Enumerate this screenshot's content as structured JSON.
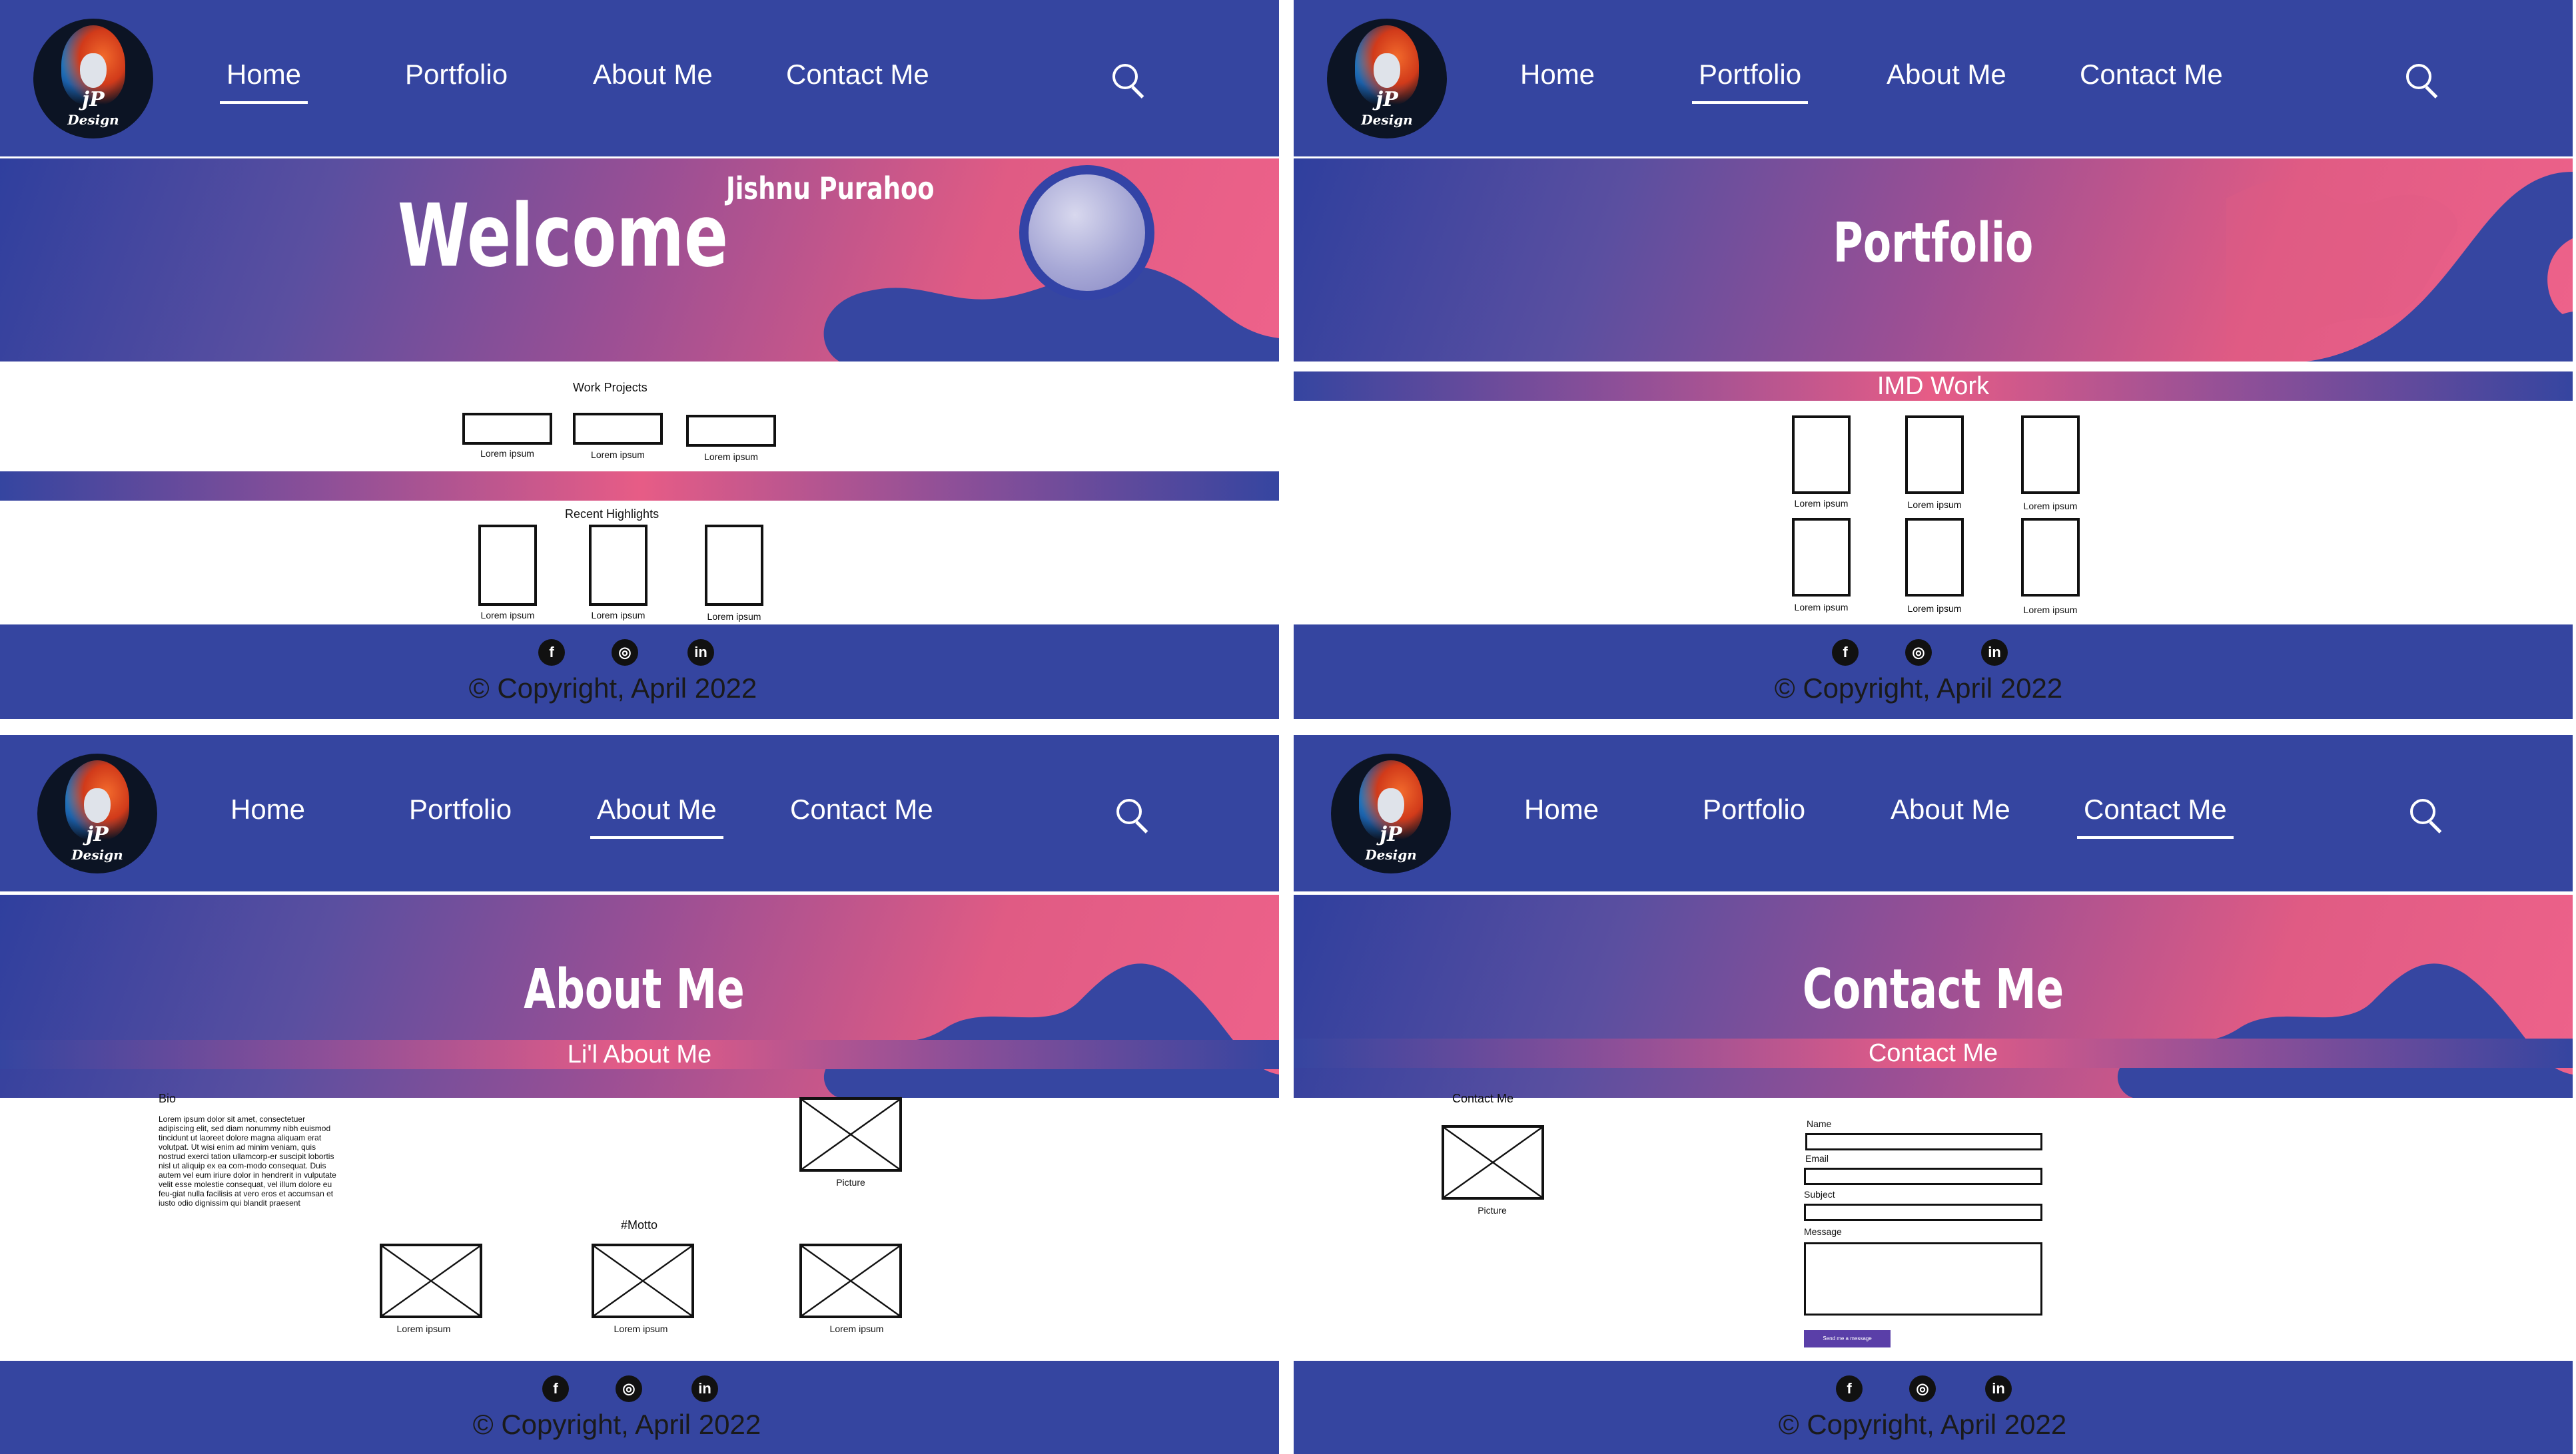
{
  "nav": {
    "items": [
      "Home",
      "Portfolio",
      "About Me",
      "Contact Me"
    ]
  },
  "logo": {
    "initials": "jP",
    "word": "Design"
  },
  "footer": {
    "copyright": "© Copyright, April 2022",
    "social": [
      "facebook-icon",
      "instagram-icon",
      "linkedin-icon"
    ],
    "social_glyphs": [
      "f",
      "◎",
      "in"
    ]
  },
  "colors": {
    "header": "#3545a0",
    "accent_pink": "#ee628a",
    "button": "#5a3fa8"
  },
  "home": {
    "hero_title": "Welcome",
    "hero_name": "Jishnu Purahoo",
    "work_projects_title": "Work Projects",
    "work_projects": [
      "Lorem ipsum",
      "Lorem ipsum",
      "Lorem ipsum"
    ],
    "recent_title": "Recent Highlights",
    "recent": [
      "Lorem ipsum",
      "Lorem ipsum",
      "Lorem ipsum"
    ]
  },
  "portfolio": {
    "hero_title": "Portfolio",
    "band_title": "IMD Work",
    "items": [
      "Lorem ipsum",
      "Lorem ipsum",
      "Lorem ipsum",
      "Lorem ipsum",
      "Lorem ipsum",
      "Lorem ipsum"
    ]
  },
  "about": {
    "hero_title": "About Me",
    "band_title": "Li'l About Me",
    "bio_title": "Bio",
    "bio_text": "Lorem ipsum dolor sit amet, consectetuer adipiscing elit, sed diam nonummy nibh euismod tincidunt ut laoreet dolore magna aliquam erat volutpat. Ut wisi enim ad minim veniam, quis nostrud exerci tation ullamcorp-er suscipit lobortis nisl ut aliquip ex ea com-modo consequat. Duis autem vel eum iriure dolor in hendrerit in vulputate velit esse molestie consequat, vel illum dolore eu feu-giat nulla facilisis at vero eros et accumsan et iusto odio dignissim qui blandit praesent",
    "picture_label": "Picture",
    "motto": "#Motto",
    "gallery": [
      "Lorem ipsum",
      "Lorem ipsum",
      "Lorem ipsum"
    ]
  },
  "contact": {
    "hero_title": "Contact Me",
    "band_title": "Contact Me",
    "side_title": "Contact Me",
    "picture_label": "Picture",
    "fields": [
      "Name",
      "Email",
      "Subject",
      "Message"
    ],
    "submit_label": "Send me a message"
  }
}
